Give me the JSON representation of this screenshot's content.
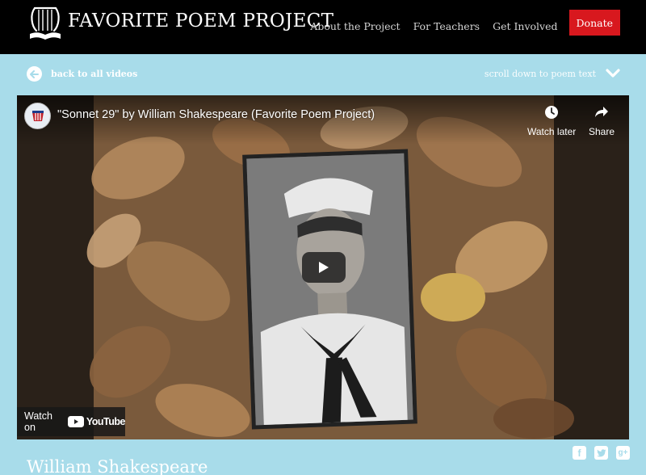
{
  "header": {
    "site_title": "FAVORITE POEM PROJECT",
    "logo_icon": "lyre-book-icon",
    "nav": [
      {
        "label": "About the Project"
      },
      {
        "label": "For Teachers"
      },
      {
        "label": "Get Involved"
      }
    ],
    "donate_label": "Donate",
    "donate_color": "#d8181e"
  },
  "subbar": {
    "back_label": "back to all videos",
    "scroll_label": "scroll down to poem text"
  },
  "video": {
    "title": "\"Sonnet 29\" by William Shakespeare (Favorite Poem Project)",
    "watch_later_label": "Watch later",
    "share_label": "Share",
    "watch_on_label": "Watch on",
    "youtube_label": "YouTube"
  },
  "share_icons": [
    "facebook-icon",
    "twitter-icon",
    "google-plus-icon"
  ],
  "poet_name": "William Shakespeare",
  "colors": {
    "background": "#a8dcea",
    "header": "#000000",
    "accent": "#d8181e"
  }
}
